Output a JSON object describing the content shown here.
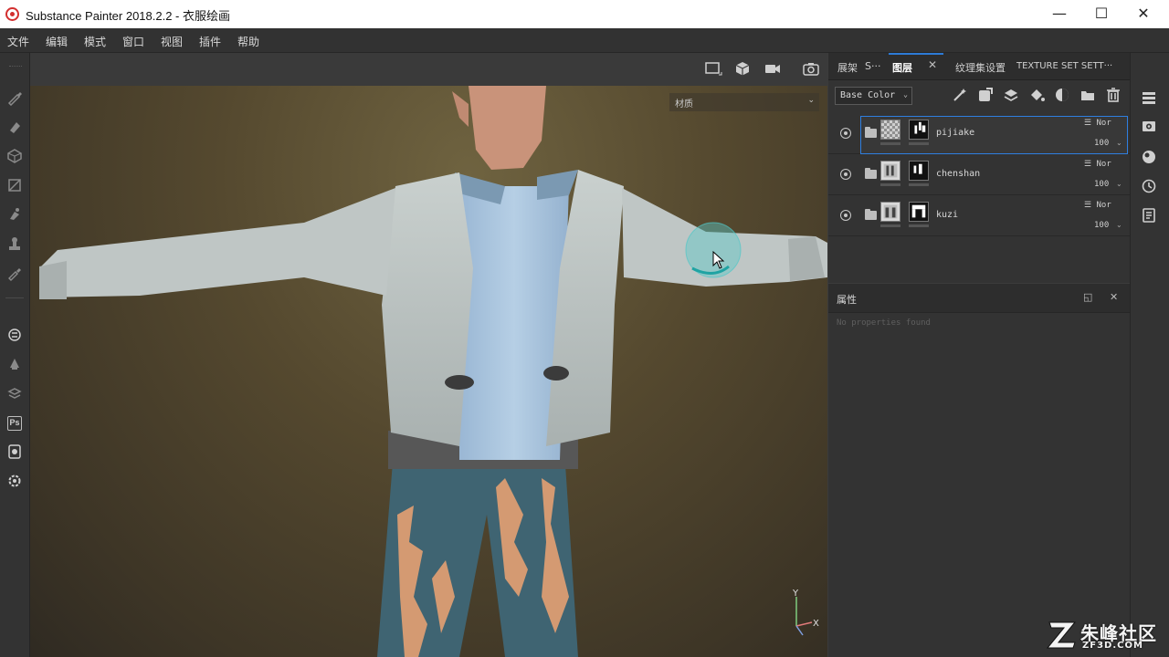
{
  "window": {
    "title": "Substance Painter 2018.2.2 - 衣服绘画",
    "minimize_glyph": "—",
    "maximize_glyph": "☐",
    "close_glyph": "✕"
  },
  "menu": [
    "文件",
    "编辑",
    "模式",
    "窗口",
    "视图",
    "插件",
    "帮助"
  ],
  "left_toolbar": {
    "icons": [
      "paint-brush-icon",
      "eraser-icon",
      "projection-icon",
      "polygon-fill-icon",
      "smudge-icon",
      "clone-stamp-icon",
      "color-picker-icon",
      "substance-icon",
      "bake-icon",
      "layers-substance-icon",
      "photoshop-icon",
      "export-icon",
      "settings-icon"
    ],
    "photoshop_label": "Ps"
  },
  "viewport": {
    "material_select": "材质",
    "axis_labels": {
      "y": "Y",
      "x": "X"
    },
    "toolbar_icons": [
      "frame-icon",
      "cube-view-icon",
      "camera-video-icon",
      "screenshot-camera-icon"
    ]
  },
  "layer_panel": {
    "tabs": [
      {
        "label": "展架"
      },
      {
        "label": "S···"
      },
      {
        "label": "图层",
        "active": true
      },
      {
        "label": "纹理集设置"
      },
      {
        "label": "TEXTURE SET SETT···"
      }
    ],
    "channel": "Base Color",
    "tool_icons": [
      "magic-wand-icon",
      "add-fill-mask-icon",
      "add-layer-icon",
      "add-fill-layer-icon",
      "add-mask-icon",
      "add-folder-icon",
      "delete-icon"
    ],
    "layers": [
      {
        "name": "pijiake",
        "blend": "Nor",
        "opacity": "100",
        "selected": true,
        "thumb": "checker"
      },
      {
        "name": "chenshan",
        "blend": "Nor",
        "opacity": "100",
        "selected": false,
        "thumb": "image"
      },
      {
        "name": "kuzi",
        "blend": "Nor",
        "opacity": "100",
        "selected": false,
        "thumb": "image"
      }
    ]
  },
  "properties_panel": {
    "title": "属性",
    "empty_text": "No properties found"
  },
  "right_strip": {
    "icons": [
      "layers-list-icon",
      "display-settings-icon",
      "shader-settings-icon",
      "history-icon",
      "log-icon"
    ]
  },
  "watermark": {
    "cn": "朱峰社区",
    "en": "ZF3D.COM"
  },
  "colors": {
    "accent": "#2d7bd6",
    "brand_red": "#d32f2f"
  }
}
